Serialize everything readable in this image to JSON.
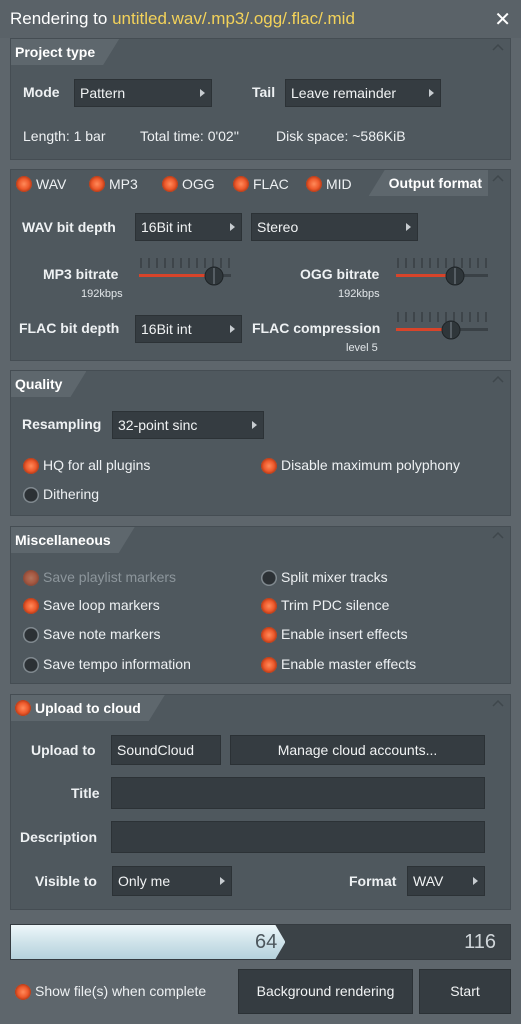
{
  "window": {
    "title_prefix": "Rendering to ",
    "title_filename": "untitled.wav/.mp3/.ogg/.flac/.mid",
    "close_label": "✕"
  },
  "project_type": {
    "header": "Project type",
    "mode_label": "Mode",
    "mode_value": "Pattern",
    "tail_label": "Tail",
    "tail_value": "Leave remainder",
    "length": "Length: 1 bar",
    "total_time": "Total time: 0'02''",
    "disk_space": "Disk space: ~586KiB"
  },
  "output_format": {
    "header": "Output format",
    "formats": [
      {
        "label": "WAV",
        "on": true
      },
      {
        "label": "MP3",
        "on": true
      },
      {
        "label": "OGG",
        "on": true
      },
      {
        "label": "FLAC",
        "on": true
      },
      {
        "label": "MID",
        "on": true
      }
    ],
    "wav_bit_depth_label": "WAV bit depth",
    "wav_bit_depth_value": "16Bit int",
    "channels_value": "Stereo",
    "mp3_bitrate_label": "MP3 bitrate",
    "mp3_bitrate_value": "192kbps",
    "ogg_bitrate_label": "OGG bitrate",
    "ogg_bitrate_value": "192kbps",
    "flac_bit_depth_label": "FLAC bit depth",
    "flac_bit_depth_value": "16Bit int",
    "flac_compression_label": "FLAC compression",
    "flac_compression_value": "level 5"
  },
  "quality": {
    "header": "Quality",
    "resampling_label": "Resampling",
    "resampling_value": "32-point sinc",
    "hq_plugins": "HQ for all plugins",
    "disable_polyphony": "Disable maximum polyphony",
    "dithering": "Dithering"
  },
  "misc": {
    "header": "Miscellaneous",
    "save_playlist_markers": "Save playlist markers",
    "save_loop_markers": "Save loop markers",
    "save_note_markers": "Save note markers",
    "save_tempo_information": "Save tempo information",
    "split_mixer_tracks": "Split mixer tracks",
    "trim_pdc_silence": "Trim PDC silence",
    "enable_insert_effects": "Enable insert effects",
    "enable_master_effects": "Enable master effects"
  },
  "cloud": {
    "header": "Upload to cloud",
    "upload_to_label": "Upload to",
    "upload_to_value": "SoundCloud",
    "manage_accounts": "Manage cloud accounts...",
    "title_label": "Title",
    "title_value": "",
    "description_label": "Description",
    "description_value": "",
    "visible_to_label": "Visible to",
    "visible_to_value": "Only me",
    "format_label": "Format",
    "format_value": "WAV"
  },
  "progress": {
    "current": "64",
    "total": "116",
    "fraction": 0.55
  },
  "footer": {
    "show_files": "Show file(s) when complete",
    "background_rendering": "Background rendering",
    "start": "Start"
  },
  "colors": {
    "accent": "#f3d25a",
    "radio_on": "#ee5a2c",
    "slider_red": "#d8442a"
  }
}
